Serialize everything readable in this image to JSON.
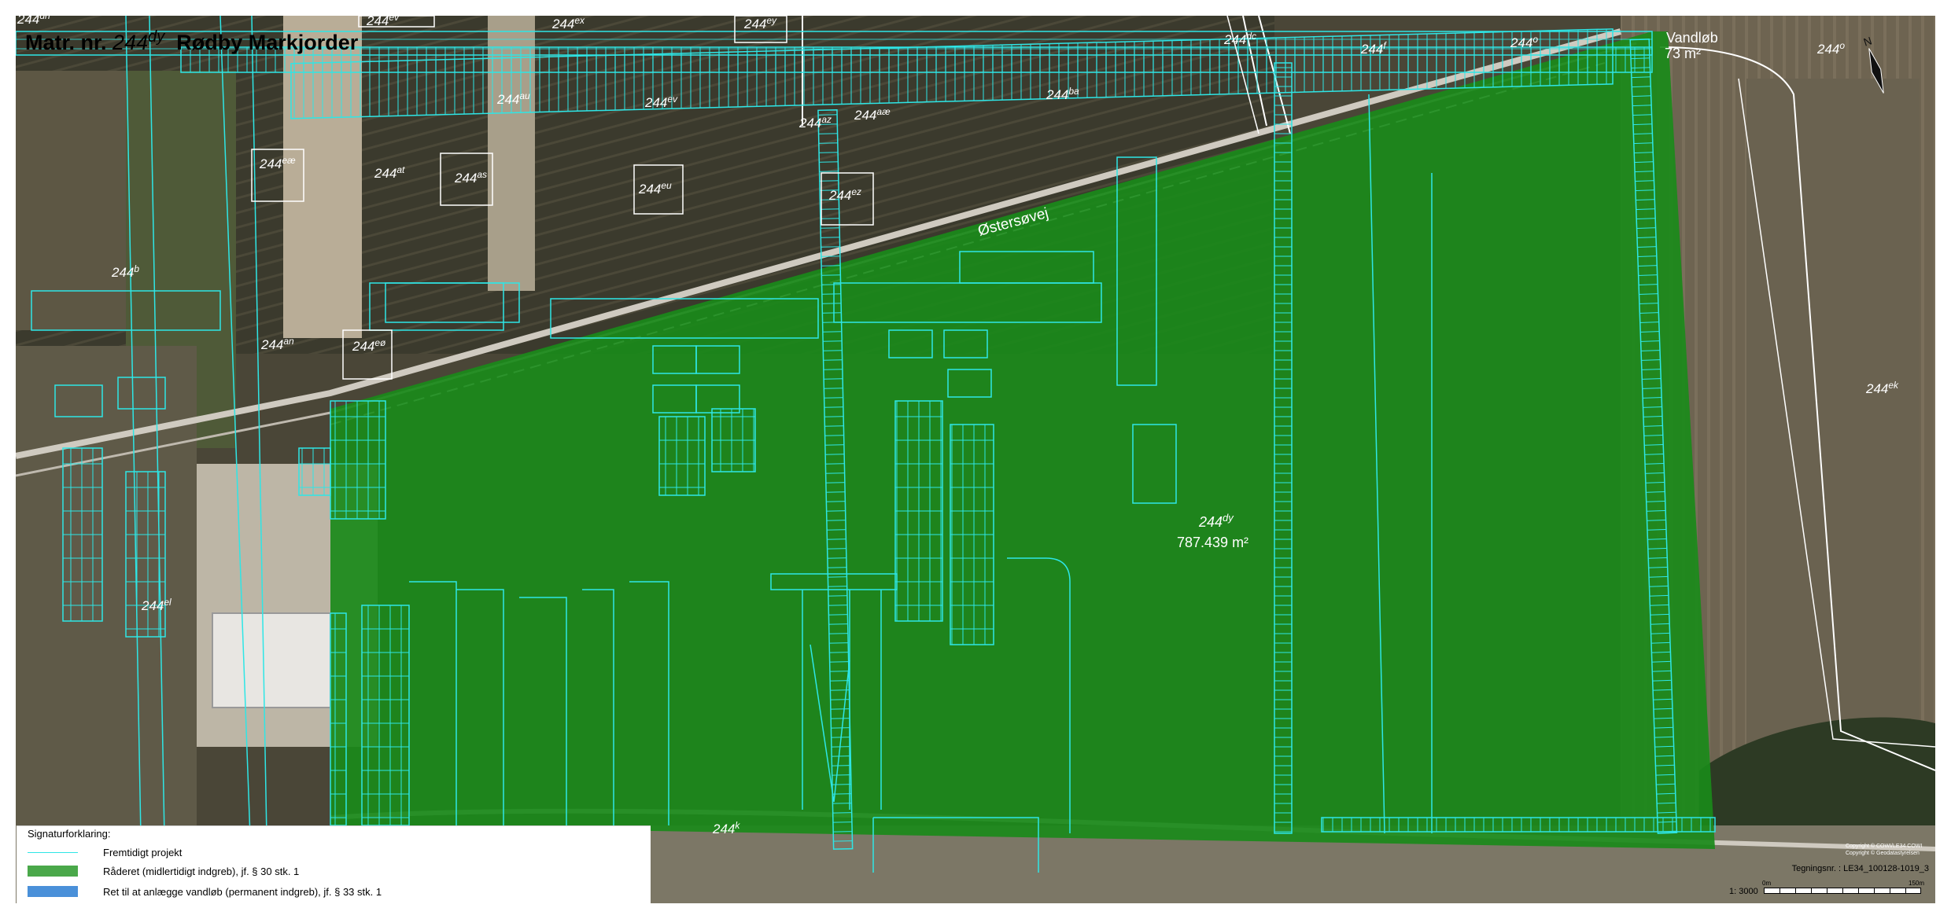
{
  "title": {
    "prefix": "Matr. nr.",
    "number": "244",
    "suffix": "dy",
    "place": "Rødby Markjorder"
  },
  "main_parcel": {
    "number": "244",
    "suffix": "dy",
    "area": "787.439 m²"
  },
  "watercourse": {
    "label": "Vandløb",
    "area": "73 m²"
  },
  "road_label": "Østersøvej",
  "parcels": [
    {
      "num": "244",
      "sup": "dh"
    },
    {
      "num": "244",
      "sup": "ev"
    },
    {
      "num": "244",
      "sup": "ex"
    },
    {
      "num": "244",
      "sup": "ey"
    },
    {
      "num": "244",
      "sup": "dc"
    },
    {
      "num": "244",
      "sup": "f"
    },
    {
      "num": "244",
      "sup": "o"
    },
    {
      "num": "244",
      "sup": "o"
    },
    {
      "num": "244",
      "sup": "au"
    },
    {
      "num": "244",
      "sup": "ev"
    },
    {
      "num": "244",
      "sup": "ba"
    },
    {
      "num": "244",
      "sup": "az"
    },
    {
      "num": "244",
      "sup": "aæ"
    },
    {
      "num": "244",
      "sup": "eæ"
    },
    {
      "num": "244",
      "sup": "at"
    },
    {
      "num": "244",
      "sup": "as"
    },
    {
      "num": "244",
      "sup": "eu"
    },
    {
      "num": "244",
      "sup": "ez"
    },
    {
      "num": "244",
      "sup": "b"
    },
    {
      "num": "244",
      "sup": "an"
    },
    {
      "num": "244",
      "sup": "eø"
    },
    {
      "num": "244",
      "sup": "el"
    },
    {
      "num": "244",
      "sup": "ek"
    },
    {
      "num": "244",
      "sup": "k"
    }
  ],
  "legend": {
    "title": "Signaturforklaring:",
    "items": [
      {
        "label": "Fremtidigt projekt",
        "color": "#2ee6e6",
        "kind": "line"
      },
      {
        "label": "Råderet (midlertidigt indgreb), jf. § 30 stk. 1",
        "color": "#4aa84a",
        "kind": "fill"
      },
      {
        "label": "Ret til at anlægge vandløb (permanent indgreb), jf. § 33 stk. 1",
        "color": "#4a90d9",
        "kind": "fill"
      }
    ]
  },
  "drawing_number": "Tegningsnr. : LE34_100128-1019_3",
  "scale": {
    "ratio": "1: 3000",
    "start": "0m",
    "end": "150m"
  },
  "north_label": "N",
  "copyright": [
    "Copyright © COWI/LE34 COWI",
    "Copyright © Geodatastyrelsen"
  ],
  "colors": {
    "green_fill": "#1c8c1c",
    "project_lines": "#2ee6e6",
    "field_dark": "#3d3a2e"
  }
}
